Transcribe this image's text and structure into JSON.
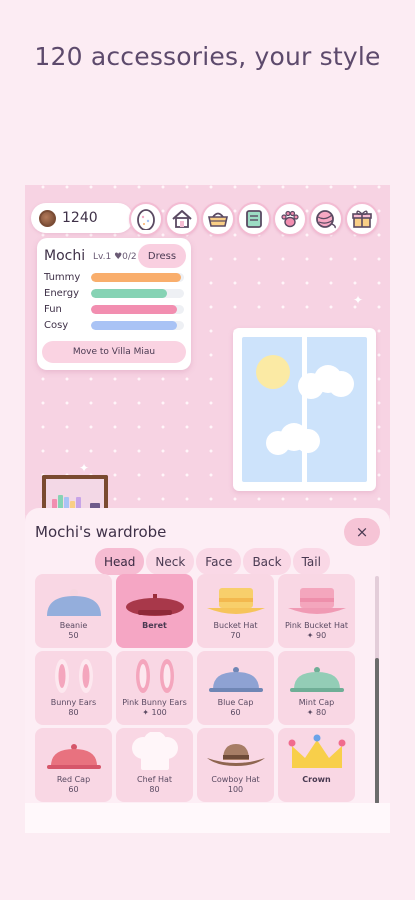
{
  "headline": "120 accessories, your style",
  "coins": "1240",
  "nav_icons": [
    "egg-icon",
    "home-icon",
    "basket-icon",
    "book-icon",
    "paw-icon",
    "yarn-ball-icon",
    "gift-icon"
  ],
  "pet": {
    "name": "Mochi",
    "level": "Lv.1 ♥0/2",
    "dress_label": "Dress",
    "move_label": "Move to Villa Miau",
    "stats": [
      {
        "label": "Tummy",
        "value": 0.97,
        "color": "#f9ae6c"
      },
      {
        "label": "Energy",
        "value": 0.82,
        "color": "#86d3b4"
      },
      {
        "label": "Fun",
        "value": 0.92,
        "color": "#f28eb0"
      },
      {
        "label": "Cosy",
        "value": 0.92,
        "color": "#a9c3f5"
      }
    ]
  },
  "wardrobe": {
    "title": "Mochi's wardrobe",
    "close_label": "×",
    "tabs": [
      "Head",
      "Neck",
      "Face",
      "Back",
      "Tail"
    ],
    "active_tab": "Head",
    "items": [
      {
        "name": "Beanie",
        "price": "50"
      },
      {
        "name": "Beret",
        "price": ""
      },
      {
        "name": "Bucket Hat",
        "price": "70"
      },
      {
        "name": "Pink Bucket Hat",
        "price": "✦ 90"
      },
      {
        "name": "Bunny Ears",
        "price": "80"
      },
      {
        "name": "Pink Bunny Ears",
        "price": "✦ 100"
      },
      {
        "name": "Blue Cap",
        "price": "60"
      },
      {
        "name": "Mint Cap",
        "price": "✦ 80"
      },
      {
        "name": "Red Cap",
        "price": "60"
      },
      {
        "name": "Chef Hat",
        "price": "80"
      },
      {
        "name": "Cowboy Hat",
        "price": "100"
      },
      {
        "name": "Crown",
        "price": ""
      }
    ]
  },
  "colors": {
    "accent": "#f5a6c4",
    "background": "#fcecf3",
    "text": "#3f3148"
  }
}
